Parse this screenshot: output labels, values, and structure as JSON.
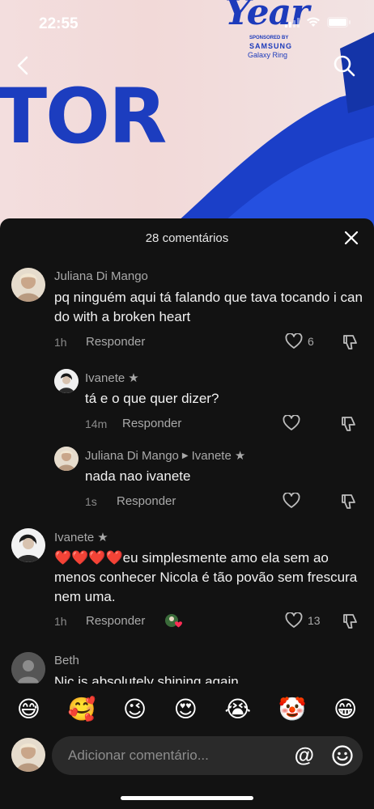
{
  "status_bar": {
    "time": "22:55"
  },
  "video": {
    "big_text": "TOR",
    "brand_year": "Year",
    "brand_small": "SPONSORED BY",
    "brand_samsung": "SAMSUNG",
    "brand_ring": "Galaxy Ring"
  },
  "nav": {
    "back_icon": "chevron-left-icon",
    "search_icon": "search-icon"
  },
  "sheet": {
    "title": "28 comentários",
    "close_icon": "close-icon"
  },
  "comments": [
    {
      "username": "Juliana Di Mango",
      "text": "pq ninguém aqui tá falando que tava tocando i can do with a broken heart",
      "time": "1h",
      "reply": "Responder",
      "likes": "6"
    },
    {
      "username": "Ivanete",
      "text": "tá e o que quer dizer?",
      "time": "14m",
      "reply": "Responder",
      "likes": ""
    },
    {
      "username": "Juliana Di Mango",
      "reply_to": "Ivanete",
      "text": "nada nao ivanete",
      "time": "1s",
      "reply": "Responder",
      "likes": ""
    },
    {
      "username": "Ivanete",
      "text_emojis": "❤️❤️❤️❤️",
      "text": "eu simplesmente amo ela sem ao menos conhecer Nicola é tão povão sem frescura nem uma.",
      "time": "1h",
      "reply": "Responder",
      "likes": "13"
    },
    {
      "username": "Beth",
      "text": "Nic is absolutely shining again"
    }
  ],
  "emoji_bar": [
    "😅",
    "🥰",
    "😉",
    "😍",
    "😭",
    "🤡",
    "😁"
  ],
  "composer": {
    "placeholder": "Adicionar comentário...",
    "at_label": "@"
  },
  "colors": {
    "sheet_bg": "#121212",
    "input_bg": "#2a2a2a",
    "heart_red": "#e0202a",
    "brand_blue": "#1c3dbf"
  }
}
